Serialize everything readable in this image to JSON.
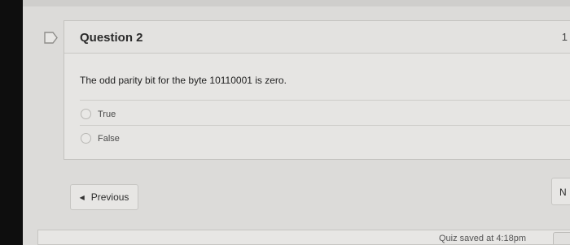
{
  "question": {
    "title": "Question 2",
    "points_partial": "1",
    "text": "The odd parity bit for the byte 10110001 is zero.",
    "options": [
      "True",
      "False"
    ]
  },
  "navigation": {
    "previous_label": "Previous",
    "next_label_partial": "N"
  },
  "footer": {
    "saved_text_partial": "Quiz saved at 4:18pm"
  },
  "icons": {
    "flag": "flag-icon",
    "previous": "caret-left-icon"
  }
}
